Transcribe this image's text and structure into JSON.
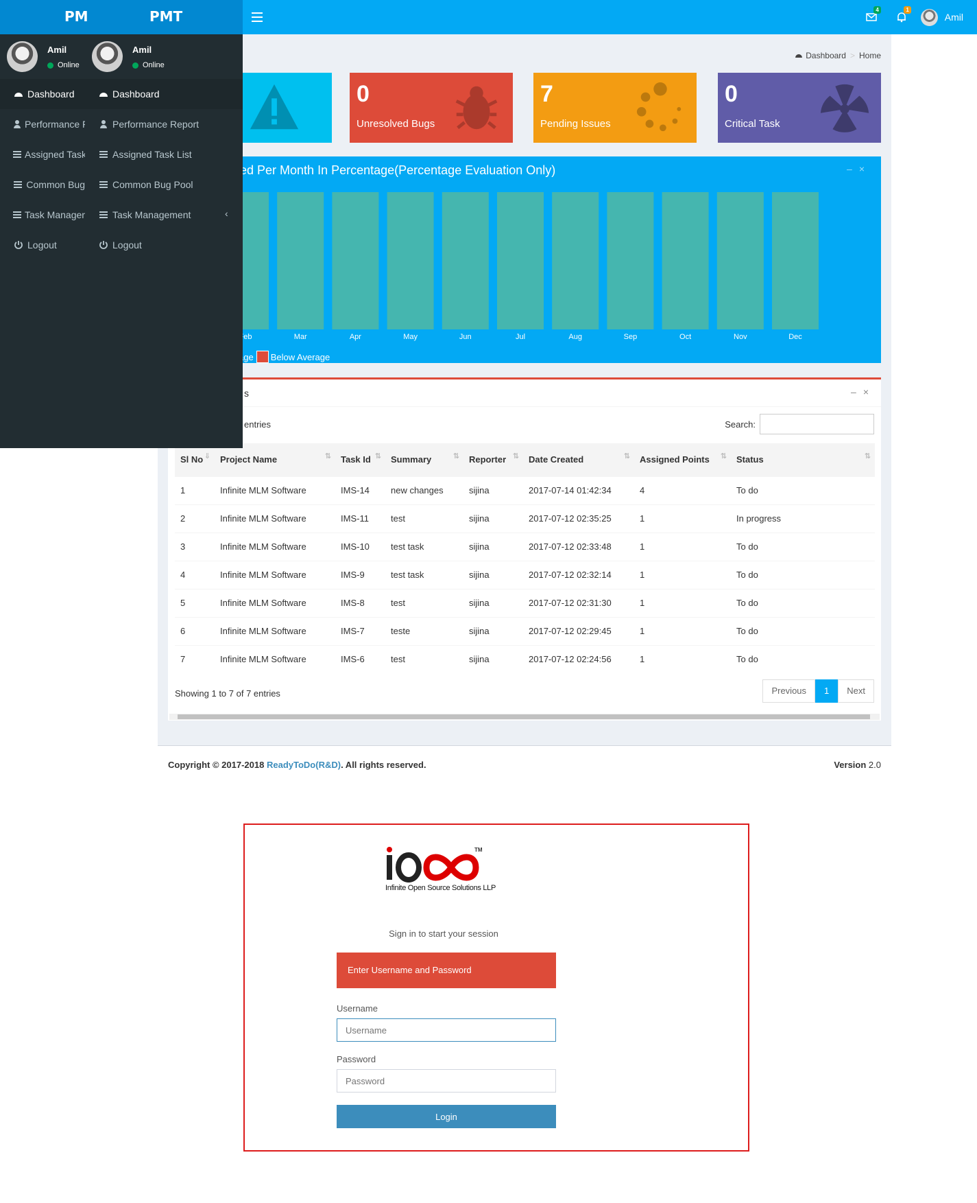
{
  "topbar": {
    "mail_badge": "4",
    "bell_badge": "1",
    "user_name": "Amil"
  },
  "sidebar": {
    "logo_mini": "PM",
    "logo_full": "PMT",
    "user": {
      "name": "Amil",
      "status": "Online"
    },
    "items": [
      {
        "label_cut": "Dashboard",
        "label": "Dashboard",
        "icon": "dashboard-icon"
      },
      {
        "label_cut": "Performance F",
        "label": "Performance Report",
        "icon": "user-icon"
      },
      {
        "label_cut": "Assigned Task",
        "label": "Assigned Task List",
        "icon": "list-icon"
      },
      {
        "label_cut": "Common Bug",
        "label": "Common Bug Pool",
        "icon": "list-icon"
      },
      {
        "label_cut": "Task Managen",
        "label": "Task Management",
        "icon": "list-icon"
      },
      {
        "label_cut": "Logout",
        "label": "Logout",
        "icon": "power-icon"
      }
    ],
    "chevron": "‹"
  },
  "breadcrumb": {
    "dashboard": "Dashboard",
    "sep": ">",
    "home": "Home"
  },
  "stat_boxes": [
    {
      "number": "",
      "label": "",
      "color": "#00c0ef",
      "icon": "warning-icon"
    },
    {
      "number": "0",
      "label": "Unresolved Bugs",
      "color": "#dd4b39",
      "icon": "bug-icon"
    },
    {
      "number": "7",
      "label": "Pending Issues",
      "color": "#f39c12",
      "icon": "spinner-icon"
    },
    {
      "number": "0",
      "label": "Critical Task",
      "color": "#605ca8",
      "icon": "radiation-icon"
    }
  ],
  "chart_box": {
    "title": "ed Per Month In Percentage(Percentage Evaluation Only)",
    "legend_cut": "age",
    "legend_below": "Below Average"
  },
  "chart_data": {
    "type": "bar",
    "categories": [
      "Feb",
      "Mar",
      "Apr",
      "May",
      "Jun",
      "Jul",
      "Aug",
      "Sep",
      "Oct",
      "Nov",
      "Dec"
    ],
    "values": [
      100,
      100,
      100,
      100,
      100,
      100,
      100,
      100,
      100,
      100,
      100
    ],
    "bar_color": "#45b6af",
    "legend": [
      "Below Average"
    ]
  },
  "table_box": {
    "title": "s",
    "entries_text": "entries",
    "search_label": "Search:",
    "columns": [
      "Sl No",
      "Project Name",
      "Task Id",
      "Summary",
      "Reporter",
      "Date Created",
      "Assigned Points",
      "Status"
    ],
    "rows": [
      [
        "1",
        "Infinite MLM Software",
        "IMS-14",
        "new changes",
        "sijina",
        "2017-07-14 01:42:34",
        "4",
        "To do"
      ],
      [
        "2",
        "Infinite MLM Software",
        "IMS-11",
        "test",
        "sijina",
        "2017-07-12 02:35:25",
        "1",
        "In progress"
      ],
      [
        "3",
        "Infinite MLM Software",
        "IMS-10",
        "test task",
        "sijina",
        "2017-07-12 02:33:48",
        "1",
        "To do"
      ],
      [
        "4",
        "Infinite MLM Software",
        "IMS-9",
        "test task",
        "sijina",
        "2017-07-12 02:32:14",
        "1",
        "To do"
      ],
      [
        "5",
        "Infinite MLM Software",
        "IMS-8",
        "test",
        "sijina",
        "2017-07-12 02:31:30",
        "1",
        "To do"
      ],
      [
        "6",
        "Infinite MLM Software",
        "IMS-7",
        "teste",
        "sijina",
        "2017-07-12 02:29:45",
        "1",
        "To do"
      ],
      [
        "7",
        "Infinite MLM Software",
        "IMS-6",
        "test",
        "sijina",
        "2017-07-12 02:24:56",
        "1",
        "To do"
      ]
    ],
    "info": "Showing 1 to 7 of 7 entries",
    "pagination": {
      "prev": "Previous",
      "page": "1",
      "next": "Next"
    }
  },
  "footer": {
    "copyright": "Copyright © 2017-2018 ",
    "brand": "ReadyToDo(R&D)",
    "rights": ". All rights reserved.",
    "version_label": "Version",
    "version": "2.0"
  },
  "login": {
    "logo_text": "Infinite Open Source Solutions LLP",
    "logo_tm": "TM",
    "subtitle": "Sign in to start your session",
    "alert": "Enter Username and Password",
    "username_label": "Username",
    "username_placeholder": "Username",
    "password_label": "Password",
    "password_placeholder": "Password",
    "button": "Login"
  }
}
